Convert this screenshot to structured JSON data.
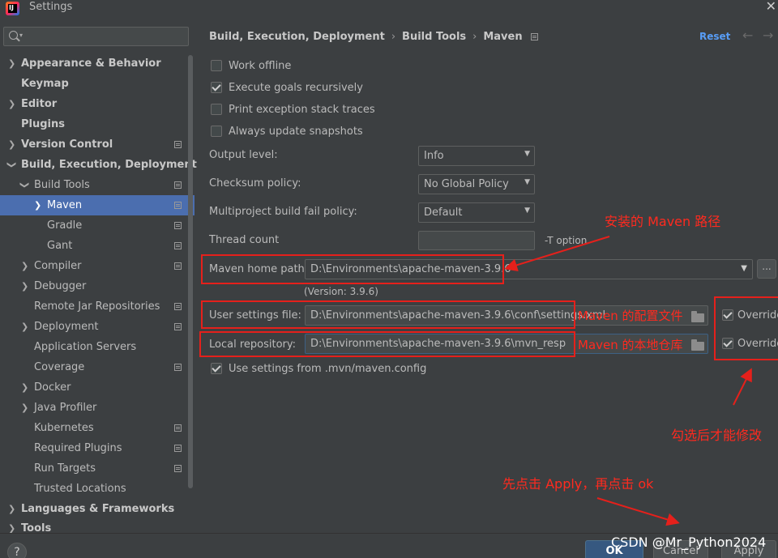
{
  "window": {
    "title": "Settings"
  },
  "sidebar": {
    "items": [
      {
        "label": "Appearance & Behavior"
      },
      {
        "label": "Keymap"
      },
      {
        "label": "Editor"
      },
      {
        "label": "Plugins"
      },
      {
        "label": "Version Control"
      },
      {
        "label": "Build, Execution, Deployment"
      },
      {
        "label": "Build Tools"
      },
      {
        "label": "Maven"
      },
      {
        "label": "Gradle"
      },
      {
        "label": "Gant"
      },
      {
        "label": "Compiler"
      },
      {
        "label": "Debugger"
      },
      {
        "label": "Remote Jar Repositories"
      },
      {
        "label": "Deployment"
      },
      {
        "label": "Application Servers"
      },
      {
        "label": "Coverage"
      },
      {
        "label": "Docker"
      },
      {
        "label": "Java Profiler"
      },
      {
        "label": "Kubernetes"
      },
      {
        "label": "Required Plugins"
      },
      {
        "label": "Run Targets"
      },
      {
        "label": "Trusted Locations"
      },
      {
        "label": "Languages & Frameworks"
      },
      {
        "label": "Tools"
      }
    ]
  },
  "breadcrumb": [
    "Build, Execution, Deployment",
    "Build Tools",
    "Maven"
  ],
  "header": {
    "reset_label": "Reset"
  },
  "checkboxes": [
    {
      "label": "Work offline",
      "checked": false
    },
    {
      "label": "Execute goals recursively",
      "checked": true
    },
    {
      "label": "Print exception stack traces",
      "checked": false
    },
    {
      "label": "Always update snapshots",
      "checked": false
    }
  ],
  "fields": {
    "output_level": {
      "label": "Output level:",
      "value": "Info"
    },
    "checksum_policy": {
      "label": "Checksum policy:",
      "value": "No Global Policy"
    },
    "fail_policy": {
      "label": "Multiproject build fail policy:",
      "value": "Default"
    },
    "thread_count": {
      "label": "Thread count",
      "value": "",
      "hint": "-T option"
    },
    "maven_home": {
      "label": "Maven home path:",
      "value": "D:\\Environments\\apache-maven-3.9.6",
      "version": "(Version: 3.9.6)",
      "browse": "..."
    },
    "user_settings": {
      "label": "User settings file:",
      "value": "D:\\Environments\\apache-maven-3.9.6\\conf\\settings.xml",
      "override": "Override"
    },
    "local_repo": {
      "label": "Local repository:",
      "value": "D:\\Environments\\apache-maven-3.9.6\\mvn_resp",
      "override": "Override"
    },
    "use_mvn_config": {
      "label": "Use settings from .mvn/maven.config",
      "checked": true
    }
  },
  "annotations": {
    "maven_path": "安装的 Maven 路径",
    "config_file": "Maven 的配置文件",
    "local_repo": "Maven 的本地仓库",
    "override_note": "勾选后才能修改",
    "apply_note": "先点击 Apply，再点击 ok"
  },
  "footer": {
    "ok_label": "OK",
    "cancel_label": "Cancel",
    "apply_label": "Apply",
    "help_label": "?"
  },
  "watermark": "CSDN @Mr_Python2024",
  "colors": {
    "accent": "#4b6eaf",
    "annotation": "#e5201b",
    "link": "#589df6"
  }
}
